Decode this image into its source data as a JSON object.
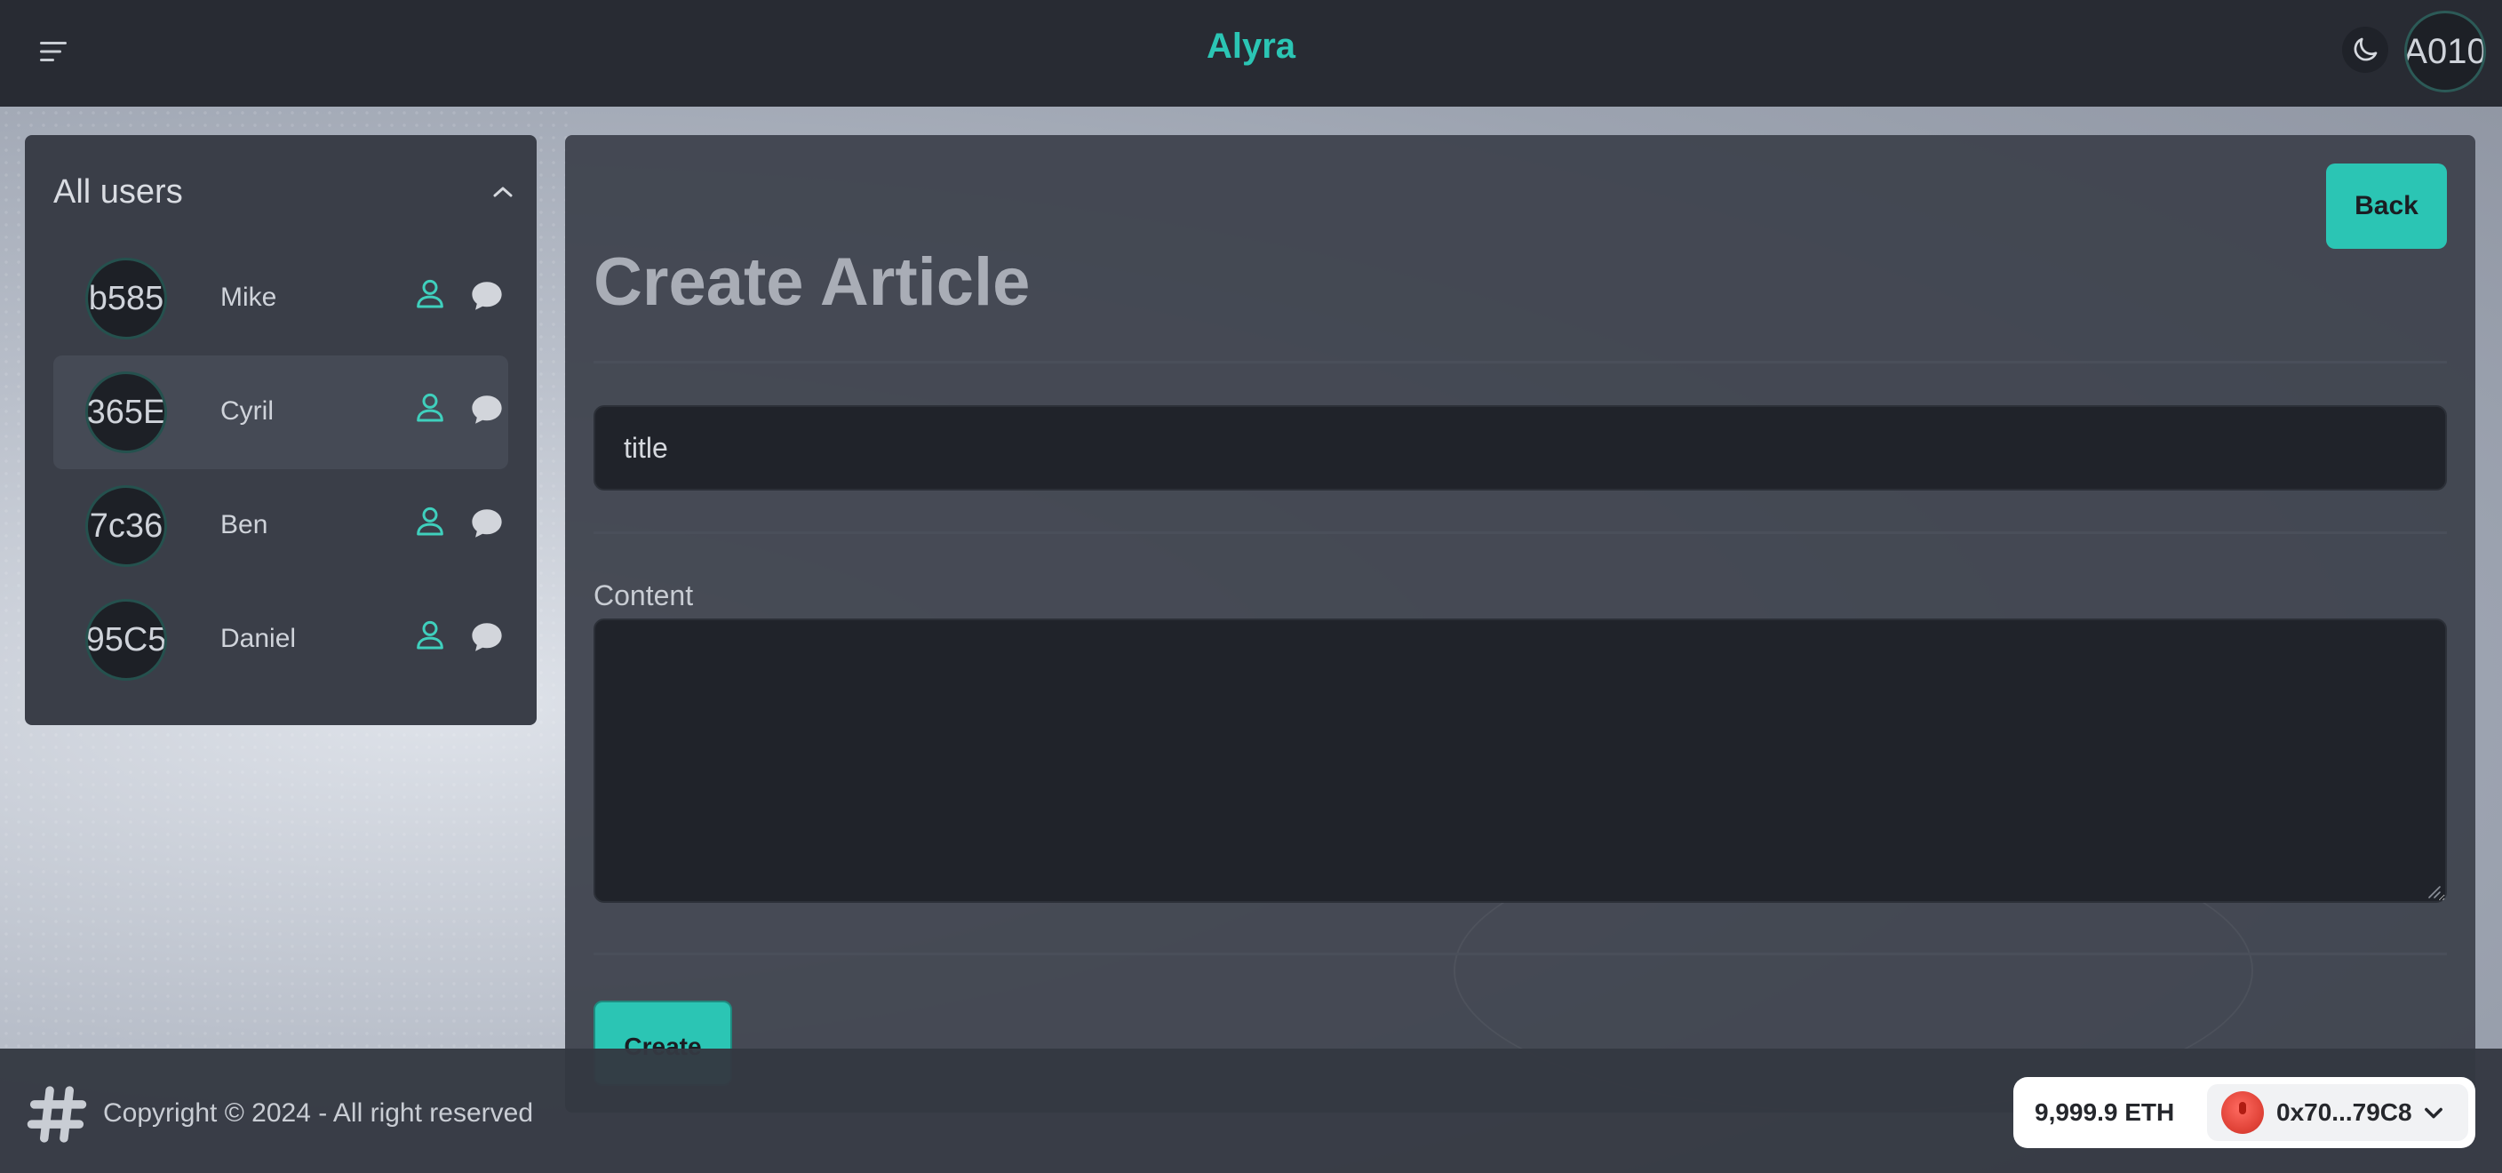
{
  "app": {
    "brand": "Alyra",
    "account_avatar_text": "A010"
  },
  "sidebar": {
    "title": "All users",
    "users": [
      {
        "avatar_text": "b585",
        "name": "Mike"
      },
      {
        "avatar_text": "365E",
        "name": "Cyril"
      },
      {
        "avatar_text": "7c36",
        "name": "Ben"
      },
      {
        "avatar_text": "95C5",
        "name": "Daniel"
      }
    ]
  },
  "main": {
    "back_label": "Back",
    "title": "Create Article",
    "title_placeholder": "title",
    "content_label": "Content",
    "content_value": "",
    "create_label": "Create"
  },
  "footer": {
    "copyright": "Copyright © 2024 - All right reserved",
    "wallet_balance": "9,999.9 ETH",
    "wallet_address": "0x70...79C8"
  },
  "colors": {
    "accent": "#2bc5b4",
    "navbar": "#282b33",
    "panel": "#3a3e48",
    "input": "#20232a"
  },
  "icons": {
    "menu": "menu-icon",
    "theme": "moon-icon",
    "collapse": "chevron-up-icon",
    "profile": "user-icon",
    "chat": "chat-bubble-icon",
    "footer_logo": "hashtag-icon",
    "wallet_dropdown": "chevron-down-icon"
  }
}
